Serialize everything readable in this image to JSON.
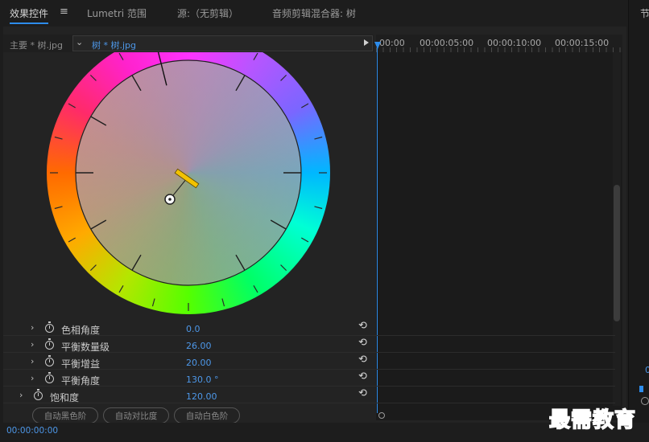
{
  "tabs": {
    "effects_controls": "效果控件",
    "menu_glyph": "≡",
    "lumetri": "Lumetri 范围",
    "source": "源:（无剪辑）",
    "mixer": "音频剪辑混合器: 树",
    "right_edge": "节"
  },
  "clip_bar": {
    "master": "主要 * 树.jpg",
    "chevron": "⌄",
    "sequence": "树 * 树.jpg"
  },
  "timeline": {
    "timecodes": [
      "00:00",
      "00:00:05:00",
      "00:00:10:00",
      "00:00:15:00"
    ]
  },
  "color_wheel": {
    "hue_angle_deg": 0,
    "balance_angle_deg": 130.0,
    "balance_magnitude": 26.0
  },
  "properties": [
    {
      "label": "色相角度",
      "value": "0.0"
    },
    {
      "label": "平衡数量级",
      "value": "26.00"
    },
    {
      "label": "平衡增益",
      "value": "20.00"
    },
    {
      "label": "平衡角度",
      "value": "130.0 °"
    },
    {
      "label": "饱和度",
      "value": "120.00"
    }
  ],
  "buttons": {
    "auto_black": "自动黑色阶",
    "auto_contrast": "自动对比度",
    "auto_white": "自动白色阶"
  },
  "bottom": {
    "time": "00:00:00:00"
  },
  "right_edge_value": "0",
  "watermark": "最需教育",
  "icons": {
    "chevron": "chevron-right-icon",
    "stopwatch": "stopwatch-icon",
    "reset": "reset-icon",
    "reset_glyph": "⟲",
    "chevron_glyph": "›"
  }
}
